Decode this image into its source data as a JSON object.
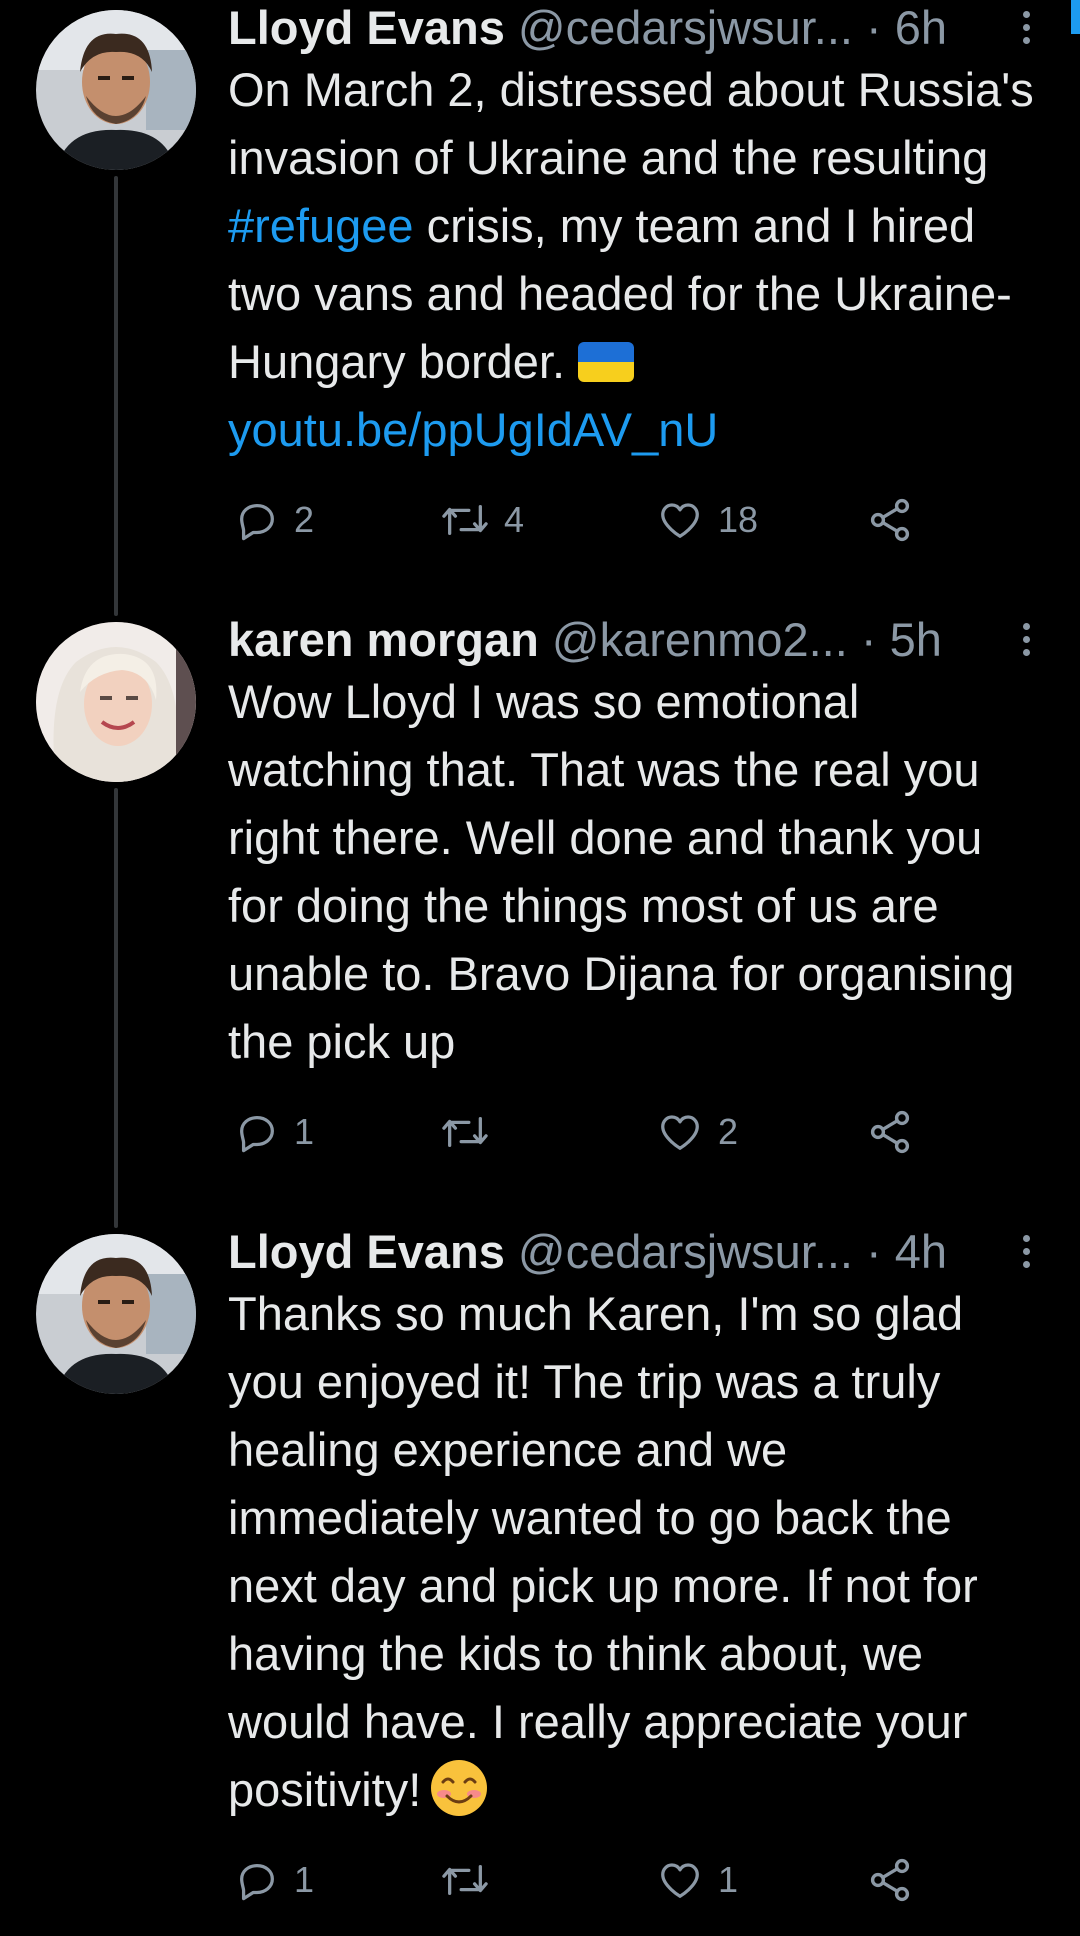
{
  "tweets": [
    {
      "name": "Lloyd Evans",
      "handle": "@cedarsjwsur...",
      "separator": "·",
      "time": "6h",
      "text_parts": {
        "p1": "On March 2, distressed about Russia's invasion of Ukraine and the resulting ",
        "hashtag": "#refugee",
        "p2": " crisis, my team and I hired two vans and headed for the Ukraine-Hungary border. ",
        "link": "youtu.be/ppUgIdAV_nU"
      },
      "replies": "2",
      "retweets": "4",
      "likes": "18",
      "avatar": "man-portrait"
    },
    {
      "name": "karen morgan",
      "handle": "@karenmo2...",
      "separator": "·",
      "time": "5h",
      "text": "Wow Lloyd I was so emotional watching that. That was the real you right there. Well done and thank you for doing the things most of us are unable to. Bravo Dijana for organising the pick up",
      "replies": "1",
      "retweets": "",
      "likes": "2",
      "avatar": "woman-portrait"
    },
    {
      "name": "Lloyd Evans",
      "handle": "@cedarsjwsur...",
      "separator": "·",
      "time": "4h",
      "text": "Thanks so much Karen, I'm so glad you enjoyed it! The trip was a truly healing experience and we immediately wanted to go back the next day and pick up more. If not for having the kids to think about, we would have. I really appreciate your positivity!",
      "emoji": "smiling-face-with-blush-emoji",
      "replies": "1",
      "retweets": "",
      "likes": "1",
      "avatar": "man-portrait"
    }
  ],
  "icons": {
    "reply": "reply-icon",
    "retweet": "retweet-icon",
    "like": "heart-icon",
    "share": "share-icon",
    "more": "more-vertical-icon",
    "flag": "ukraine-flag-emoji"
  },
  "colors": {
    "background": "#000000",
    "text": "#e7e9ea",
    "secondary": "#8b98a5",
    "accent": "#1d9bf0",
    "thread_line": "#333639"
  }
}
